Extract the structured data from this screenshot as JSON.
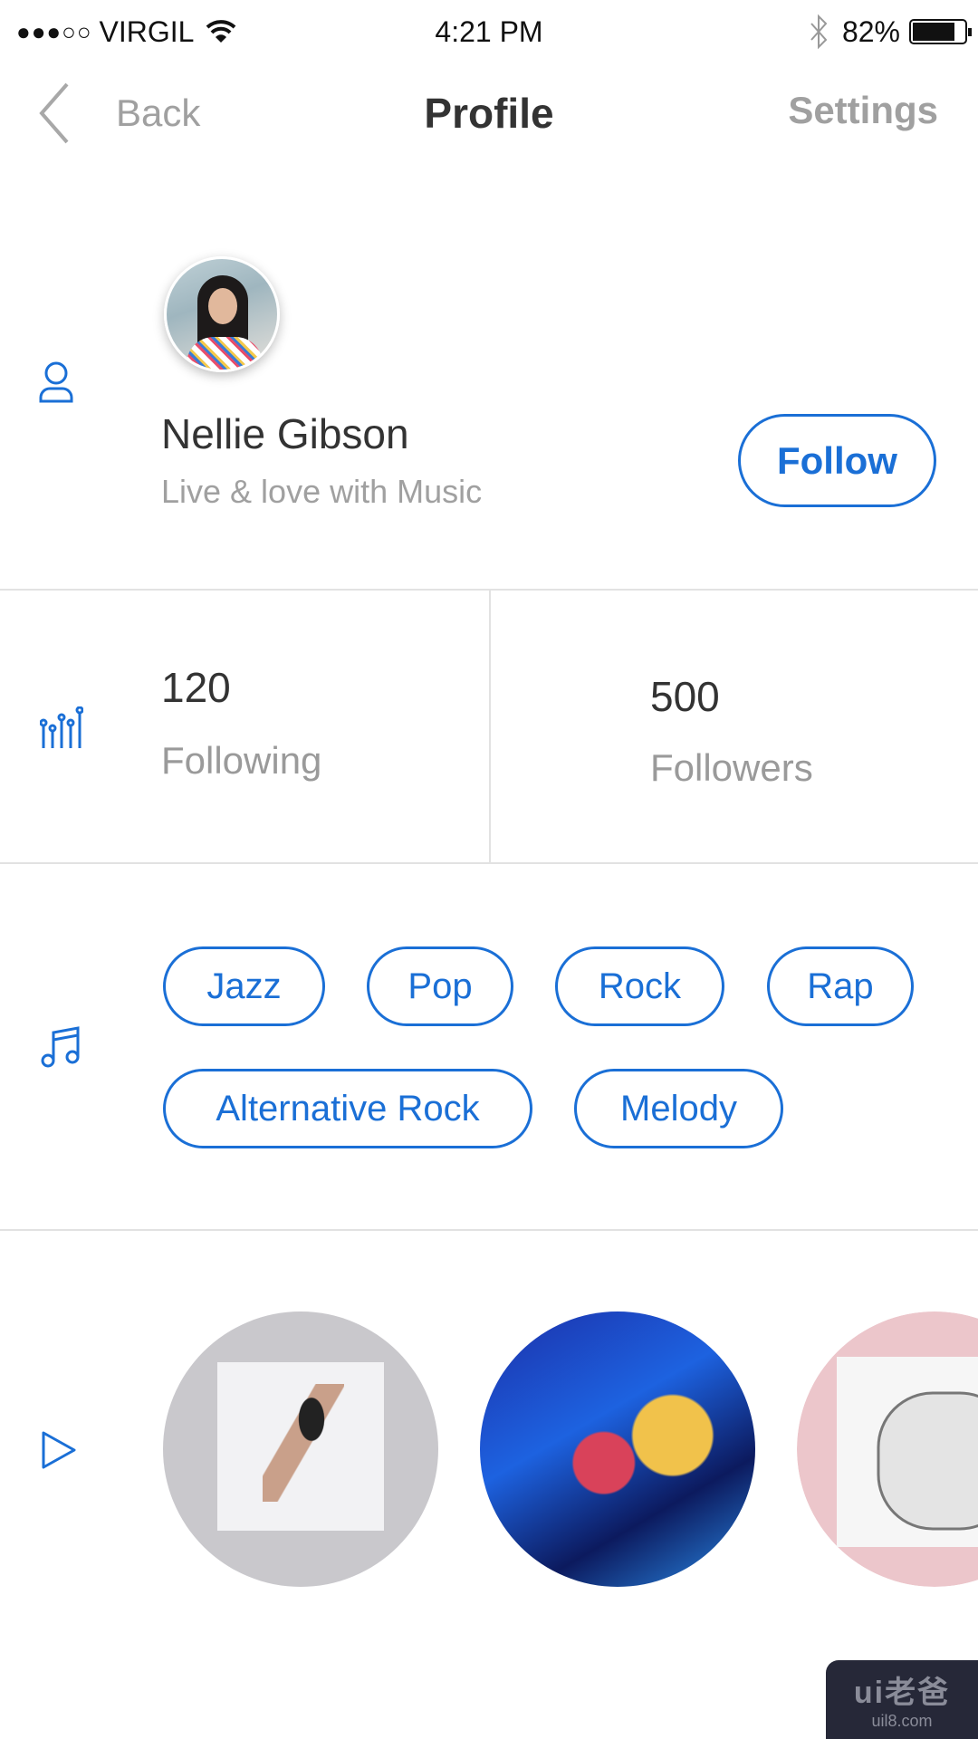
{
  "status_bar": {
    "carrier": "VIRGIL",
    "time": "4:21 PM",
    "battery": "82%",
    "signal_bars_filled": 3,
    "signal_bars_total": 5
  },
  "nav": {
    "back_label": "Back",
    "title": "Profile",
    "settings_label": "Settings"
  },
  "profile": {
    "name": "Nellie Gibson",
    "tagline": "Live & love with Music",
    "follow_label": "Follow"
  },
  "stats": {
    "following_count": "120",
    "following_label": "Following",
    "followers_count": "500",
    "followers_label": "Followers"
  },
  "genres": [
    "Jazz",
    "Pop",
    "Rock",
    "Rap",
    "Alternative Rock",
    "Melody"
  ],
  "albums": [
    {
      "art": "nicki-minaj-album"
    },
    {
      "art": "lorde-melodrama"
    },
    {
      "art": "katy-perry-album"
    }
  ],
  "colors": {
    "accent": "#1a6fd6",
    "text": "#333333",
    "muted": "#9a9a9a",
    "divider": "#e2e2e2"
  },
  "watermark": {
    "logo": "ui老爸",
    "url": "uil8.com"
  }
}
